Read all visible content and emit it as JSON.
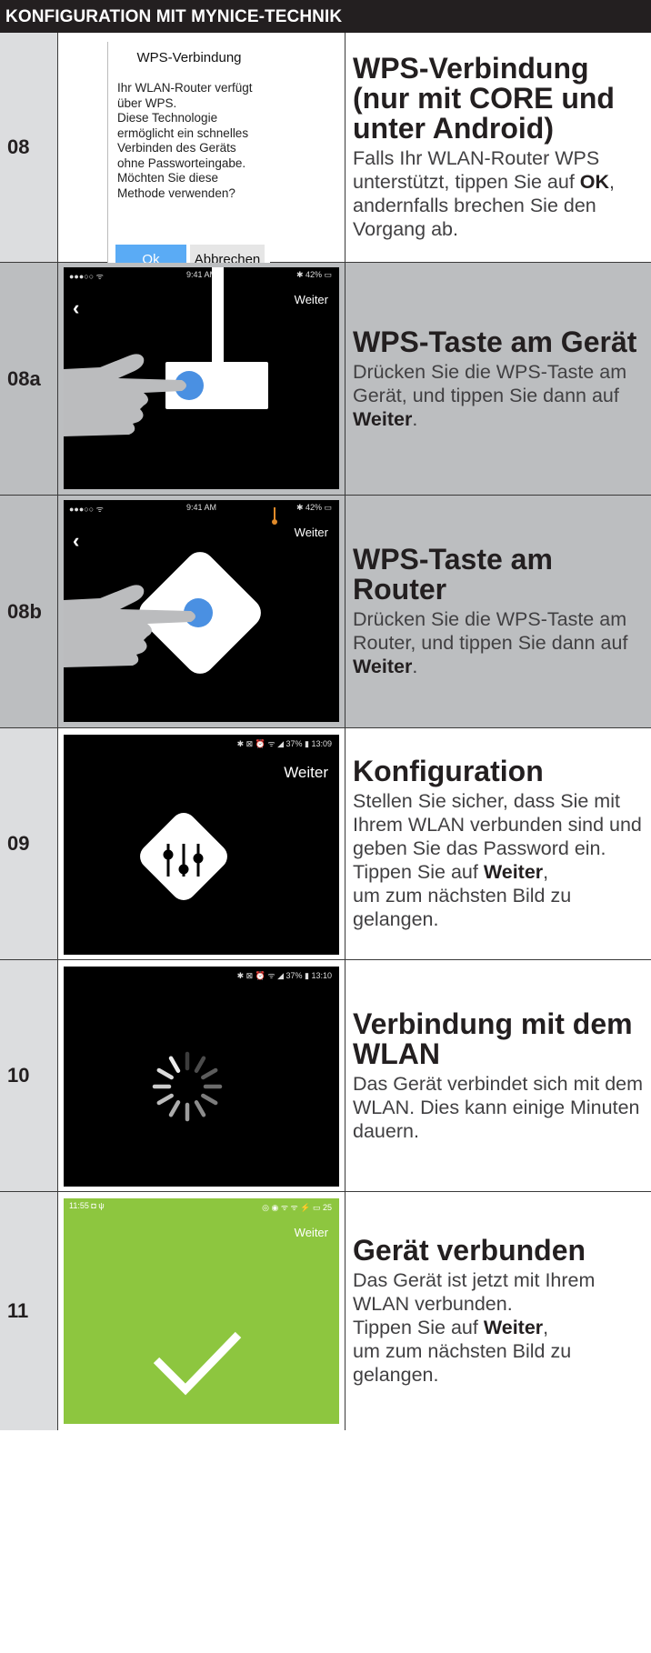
{
  "header": {
    "title": "KONFIGURATION MIT MYNICE-TECHNIK"
  },
  "rows": [
    {
      "num": "08",
      "title": "WPS-Verbindung (nur mit CORE und unter Android)",
      "text_before": "Falls Ihr WLAN-Router WPS unterstützt, tippen Sie auf ",
      "bold": "OK",
      "text_after": ", andernfalls brechen Sie den Vorgang ab.",
      "dialog": {
        "title": "WPS-Verbindung",
        "body": "Ihr WLAN-Router verfügt über WPS.\nDiese Technologie ermöglicht ein schnelles Verbinden des Geräts ohne Passworteingabe.\nMöchten Sie diese Methode verwenden?",
        "ok_label": "Ok",
        "cancel_label": "Abbrechen",
        "ok_color": "#5aabf5"
      }
    },
    {
      "num": "08a",
      "title": "WPS-Taste am Gerät",
      "text_before": "Drücken Sie die WPS-Taste am Gerät, und tippen Sie dann auf ",
      "bold": "Weiter",
      "text_after": ".",
      "screen": {
        "status_left": "●●●○○ ᯤ",
        "status_center": "9:41 AM",
        "status_right": "✱ 42% ▭",
        "weiter": "Weiter",
        "back_icon": "chevron-left-icon"
      }
    },
    {
      "num": "08b",
      "title": "WPS-Taste am Router",
      "text_before": "Drücken Sie die WPS-Taste am Router, und tippen Sie dann auf ",
      "bold": "Weiter",
      "text_after": ".",
      "screen": {
        "status_left": "●●●○○ ᯤ",
        "status_center": "9:41 AM",
        "status_right": "✱ 42% ▭",
        "weiter": "Weiter",
        "back_icon": "chevron-left-icon"
      }
    },
    {
      "num": "09",
      "title": "Konfiguration",
      "text_before": "Stellen Sie sicher, dass Sie mit Ihrem WLAN verbunden sind und geben Sie das Password ein.\nTippen Sie auf ",
      "bold": "Weiter",
      "text_after": ",\num zum nächsten Bild zu gelangen.",
      "screen": {
        "status_right": "✱ ⊠ ⏰ ᯤ ◢ 37% ▮ 13:09",
        "weiter": "Weiter"
      }
    },
    {
      "num": "10",
      "title": "Verbindung mit dem WLAN",
      "text_before": "Das Gerät verbindet sich mit dem WLAN. Dies kann einige Minuten dauern.",
      "bold": "",
      "text_after": "",
      "screen": {
        "status_right": "✱ ⊠ ⏰ ᯤ ◢ 37% ▮ 13:10"
      }
    },
    {
      "num": "11",
      "title": "Gerät verbunden",
      "text_before": "Das Gerät ist jetzt mit Ihrem WLAN verbunden.\nTippen Sie auf ",
      "bold": "Weiter",
      "text_after": ",\num zum nächsten Bild zu gelangen.",
      "screen": {
        "status_left": "11:55 ◘ ψ",
        "status_right": "◎ ◉ ᯤ ᯤ ⚡ ▭ 25",
        "weiter": "Weiter",
        "bg": "#8dc63f"
      }
    }
  ],
  "colors": {
    "header_bg": "#231f20",
    "gray_row": "#bcbec0",
    "num_cell": "#dcdddf",
    "accent_blue": "#4a90e2",
    "wps_orange": "#e08a2a",
    "success_green": "#8dc63f"
  }
}
